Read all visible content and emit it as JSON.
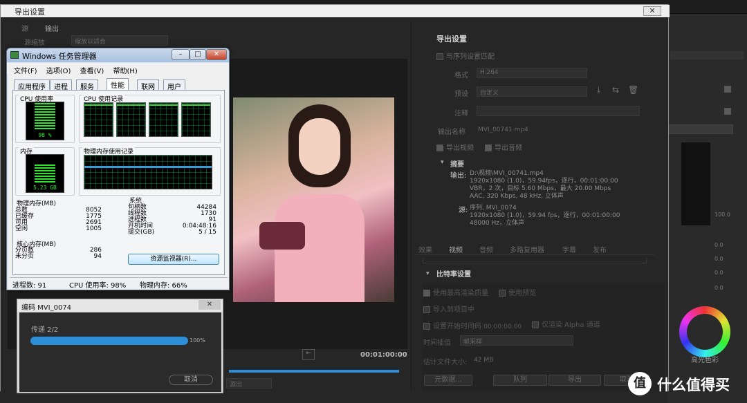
{
  "export_dialog": {
    "title": "导出设置",
    "close_label": "✕",
    "tabs": [
      "源",
      "输出"
    ],
    "source_scaling_label": "源缩放",
    "source_scaling_value": "缩放以适合",
    "export_settings_heading": "导出设置",
    "match_sequence_label": "与序列设置匹配",
    "format_label": "格式",
    "format_value": "H.264",
    "preset_label": "预设",
    "preset_value": "自定义",
    "comments_label": "注释",
    "output_name_label": "输出名称",
    "output_name_value": "MVI_00741.mp4",
    "export_video_label": "导出视频",
    "export_audio_label": "导出音频",
    "summary_heading": "摘要",
    "summary_output_label": "输出:",
    "summary_output_lines": [
      "D:\\视频\\MVI_00741.mp4",
      "1920x1080 (1.0)，59.94fps，逐行，00:01:00:00",
      "VBR，2 次，目标 5.60 Mbps，最大 20.00 Mbps",
      "AAC, 320 Kbps, 48 kHz, 立体声"
    ],
    "summary_source_label": "源:",
    "summary_source_lines": [
      "序列, MVI_0074",
      "1920x1080 (1.0)，59.94 fps，逐行，00:01:00:00",
      "48000 Hz，立体声"
    ],
    "lower_tabs": [
      "效果",
      "视频",
      "音频",
      "多路复用器",
      "字幕",
      "发布"
    ],
    "bitrate_heading": "比特率设置",
    "max_render_quality_label": "使用最高渲染质量",
    "use_previews_label": "使用预览",
    "import_into_project_label": "导入到项目中",
    "set_start_timecode_label": "设置开始时间码",
    "start_timecode_value": "00:00:00:00",
    "render_alpha_label": "仅渲染 Alpha 通道",
    "time_interpolation_label": "时间插值",
    "time_interpolation_value": "帧采样",
    "estimated_size_label": "估计文件大小:",
    "estimated_size_value": "42 MB",
    "buttons": [
      "元数据...",
      "队列",
      "导出",
      "取消"
    ],
    "timecode": "00:01:00:00",
    "range_value": "源出"
  },
  "task_manager": {
    "title": "Windows 任务管理器",
    "controls": [
      "–",
      "□",
      "✕"
    ],
    "menu": [
      "文件(F)",
      "选项(O)",
      "查看(V)",
      "帮助(H)"
    ],
    "tabs": [
      "应用程序",
      "进程",
      "服务",
      "性能",
      "联网",
      "用户"
    ],
    "active_tab": "性能",
    "cpu_usage_label": "CPU 使用率",
    "cpu_usage_value": "98 %",
    "cpu_usage_fraction": 0.98,
    "cpu_history_label": "CPU 使用记录",
    "memory_label": "内存",
    "memory_value": "5.23 GB",
    "memory_fraction": 0.66,
    "physical_memory_history_label": "物理内存使用记录",
    "physical_memory_heading": "物理内存(MB)",
    "physical_memory": [
      {
        "k": "总数",
        "v": "8052"
      },
      {
        "k": "已缓存",
        "v": "1775"
      },
      {
        "k": "可用",
        "v": "2691"
      },
      {
        "k": "空闲",
        "v": "1005"
      }
    ],
    "kernel_memory_heading": "核心内存(MB)",
    "kernel_memory": [
      {
        "k": "分页数",
        "v": "286"
      },
      {
        "k": "未分页",
        "v": "94"
      }
    ],
    "system_heading": "系统",
    "system": [
      {
        "k": "句柄数",
        "v": "44284"
      },
      {
        "k": "线程数",
        "v": "1730"
      },
      {
        "k": "进程数",
        "v": "91"
      },
      {
        "k": "开机时间",
        "v": "0:04:48:16"
      },
      {
        "k": "提交(GB)",
        "v": "5 / 15"
      }
    ],
    "resource_monitor_button": "资源监视器(R)...",
    "status_processes": "进程数: 91",
    "status_cpu": "CPU 使用率: 98%",
    "status_memory": "物理内存: 66%"
  },
  "encode_dialog": {
    "title": "编码 MVI_0074",
    "close_label": "✕",
    "pass_label": "传递 2/2",
    "progress_text": "100%",
    "progress_fraction": 1.0,
    "cancel_label": "取消"
  },
  "right_panel": {
    "values": [
      "0.0",
      "0.0",
      "0.0",
      "0.0",
      "0.0",
      "100.0"
    ],
    "scale_value": "100.0",
    "highlight_label": "高光色彩"
  },
  "watermark": {
    "logo_char": "值",
    "text": "什么值得买"
  }
}
